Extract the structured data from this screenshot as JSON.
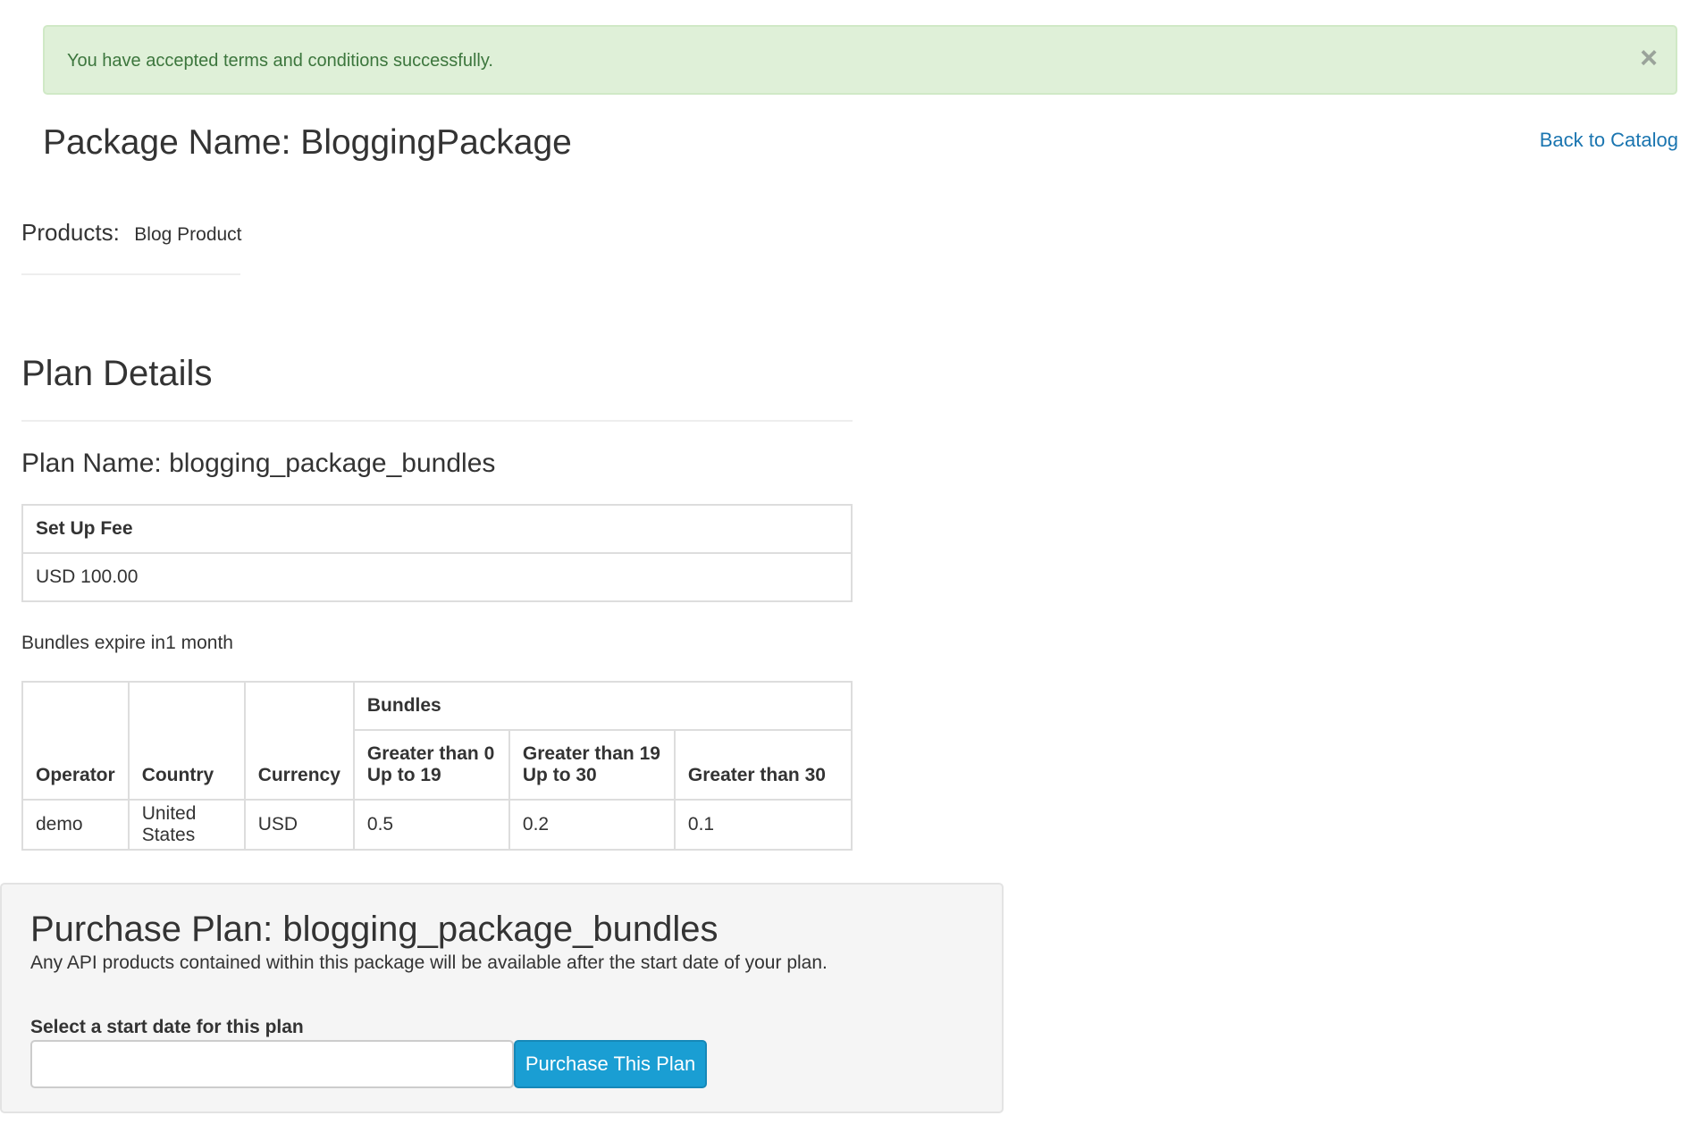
{
  "alert": {
    "message": "You have accepted terms and conditions successfully.",
    "close_label": "×"
  },
  "header": {
    "package_title": "Package Name: BloggingPackage",
    "back_link": "Back to Catalog"
  },
  "products": {
    "label": "Products:",
    "value": "Blog Product"
  },
  "plan": {
    "section_title": "Plan Details",
    "name": "Plan Name: blogging_package_bundles",
    "setup_fee_header": "Set Up Fee",
    "setup_fee_value": "USD 100.00",
    "bundle_expiry": "Bundles expire in1 month"
  },
  "bundle_table": {
    "group_header": "Bundles",
    "headers": {
      "operator": "Operator",
      "country": "Country",
      "currency": "Currency",
      "tier1_line1": "Greater than 0",
      "tier1_line2": "Up to 19",
      "tier2_line1": "Greater than 19",
      "tier2_line2": "Up to 30",
      "tier3": "Greater than 30"
    },
    "rows": [
      {
        "operator": "demo",
        "country": "United States",
        "currency": "USD",
        "tier1": "0.5",
        "tier2": "0.2",
        "tier3": "0.1"
      }
    ]
  },
  "purchase": {
    "title": "Purchase Plan: blogging_package_bundles",
    "description": "Any API products contained within this package will be available after the start date of your plan.",
    "start_label": "Select a start date for this plan",
    "start_value": "",
    "button_label": "Purchase This Plan"
  },
  "colors": {
    "alert_bg": "#dff0d8",
    "alert_text": "#3c763d",
    "link": "#1a75b0",
    "button": "#1a9ed3"
  }
}
